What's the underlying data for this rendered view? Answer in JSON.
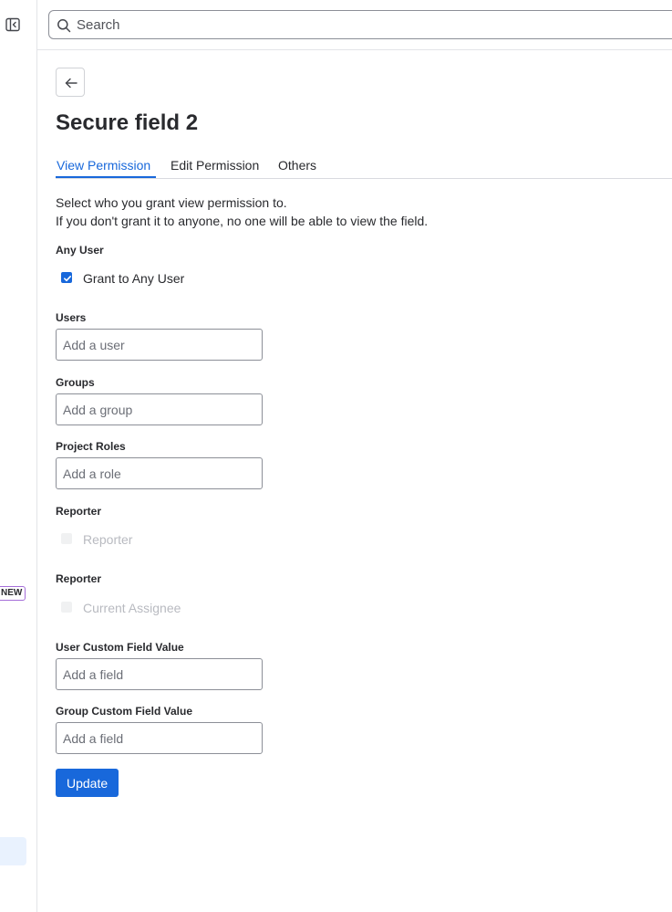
{
  "search": {
    "placeholder": "Search"
  },
  "sidebar": {
    "badge": "NEW"
  },
  "page": {
    "title": "Secure field 2"
  },
  "tabs": [
    {
      "label": "View Permission",
      "active": true
    },
    {
      "label": "Edit Permission",
      "active": false
    },
    {
      "label": "Others",
      "active": false
    }
  ],
  "description": {
    "line1": "Select who you grant view permission to.",
    "line2": "If you don't grant it to anyone, no one will be able to view the field."
  },
  "form": {
    "any_user": {
      "label": "Any User",
      "checkbox_label": "Grant to Any User",
      "checked": true
    },
    "users": {
      "label": "Users",
      "placeholder": "Add a user"
    },
    "groups": {
      "label": "Groups",
      "placeholder": "Add a group"
    },
    "project_roles": {
      "label": "Project Roles",
      "placeholder": "Add a role"
    },
    "reporter": {
      "label": "Reporter",
      "checkbox_label": "Reporter",
      "disabled": true
    },
    "assignee": {
      "label": "Reporter",
      "checkbox_label": "Current Assignee",
      "disabled": true
    },
    "user_custom_field": {
      "label": "User Custom Field Value",
      "placeholder": "Add a field"
    },
    "group_custom_field": {
      "label": "Group Custom Field Value",
      "placeholder": "Add a field"
    },
    "submit_label": "Update"
  },
  "colors": {
    "accent": "#1868db",
    "text": "#292a2e",
    "border": "#8c8f97",
    "disabled_text": "#b8bac0"
  }
}
